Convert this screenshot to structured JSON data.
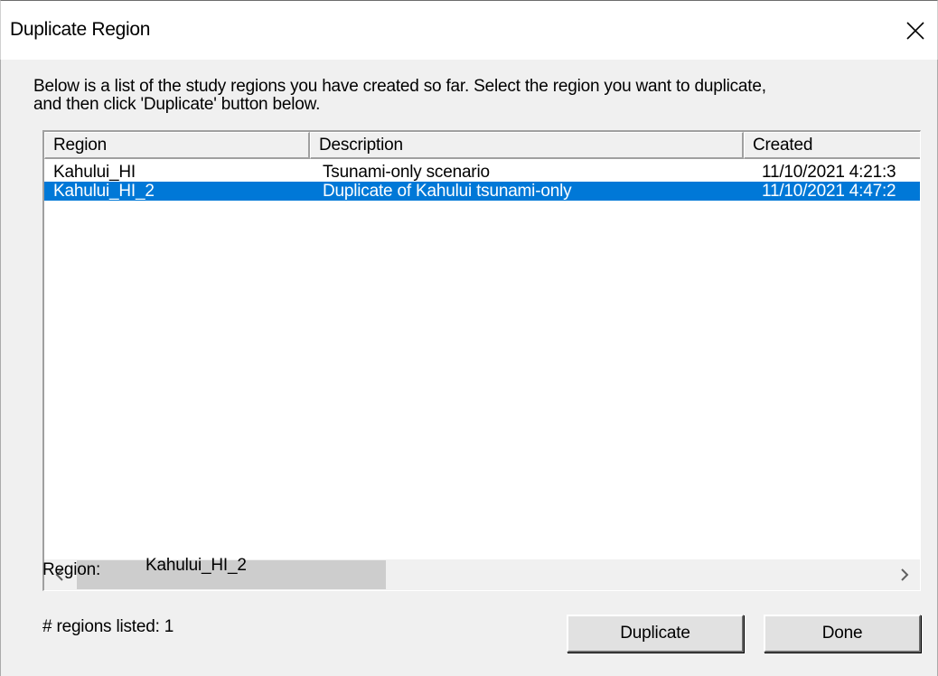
{
  "window": {
    "title": "Duplicate Region"
  },
  "instructions": "Below is a list of the study regions you have created so far.  Select the region you want to duplicate,\nand then click 'Duplicate' button below.",
  "list": {
    "columns": [
      "Region",
      "Description",
      "Created"
    ],
    "rows": [
      {
        "region": "Kahului_HI",
        "description": "Tsunami-only scenario",
        "created": "11/10/2021 4:21:3",
        "selected": false
      },
      {
        "region": "Kahului_HI_2",
        "description": "Duplicate of Kahului tsunami-only",
        "created": "11/10/2021 4:47:2",
        "selected": true
      }
    ],
    "scrollbar_position": 0.0
  },
  "region_field": {
    "label": "Region:",
    "value": "Kahului_HI_2"
  },
  "count_text": "# regions listed: 1",
  "buttons": {
    "duplicate": "Duplicate",
    "done": "Done"
  },
  "colors": {
    "selection": "#0078d7",
    "background": "#f0f0f0"
  }
}
